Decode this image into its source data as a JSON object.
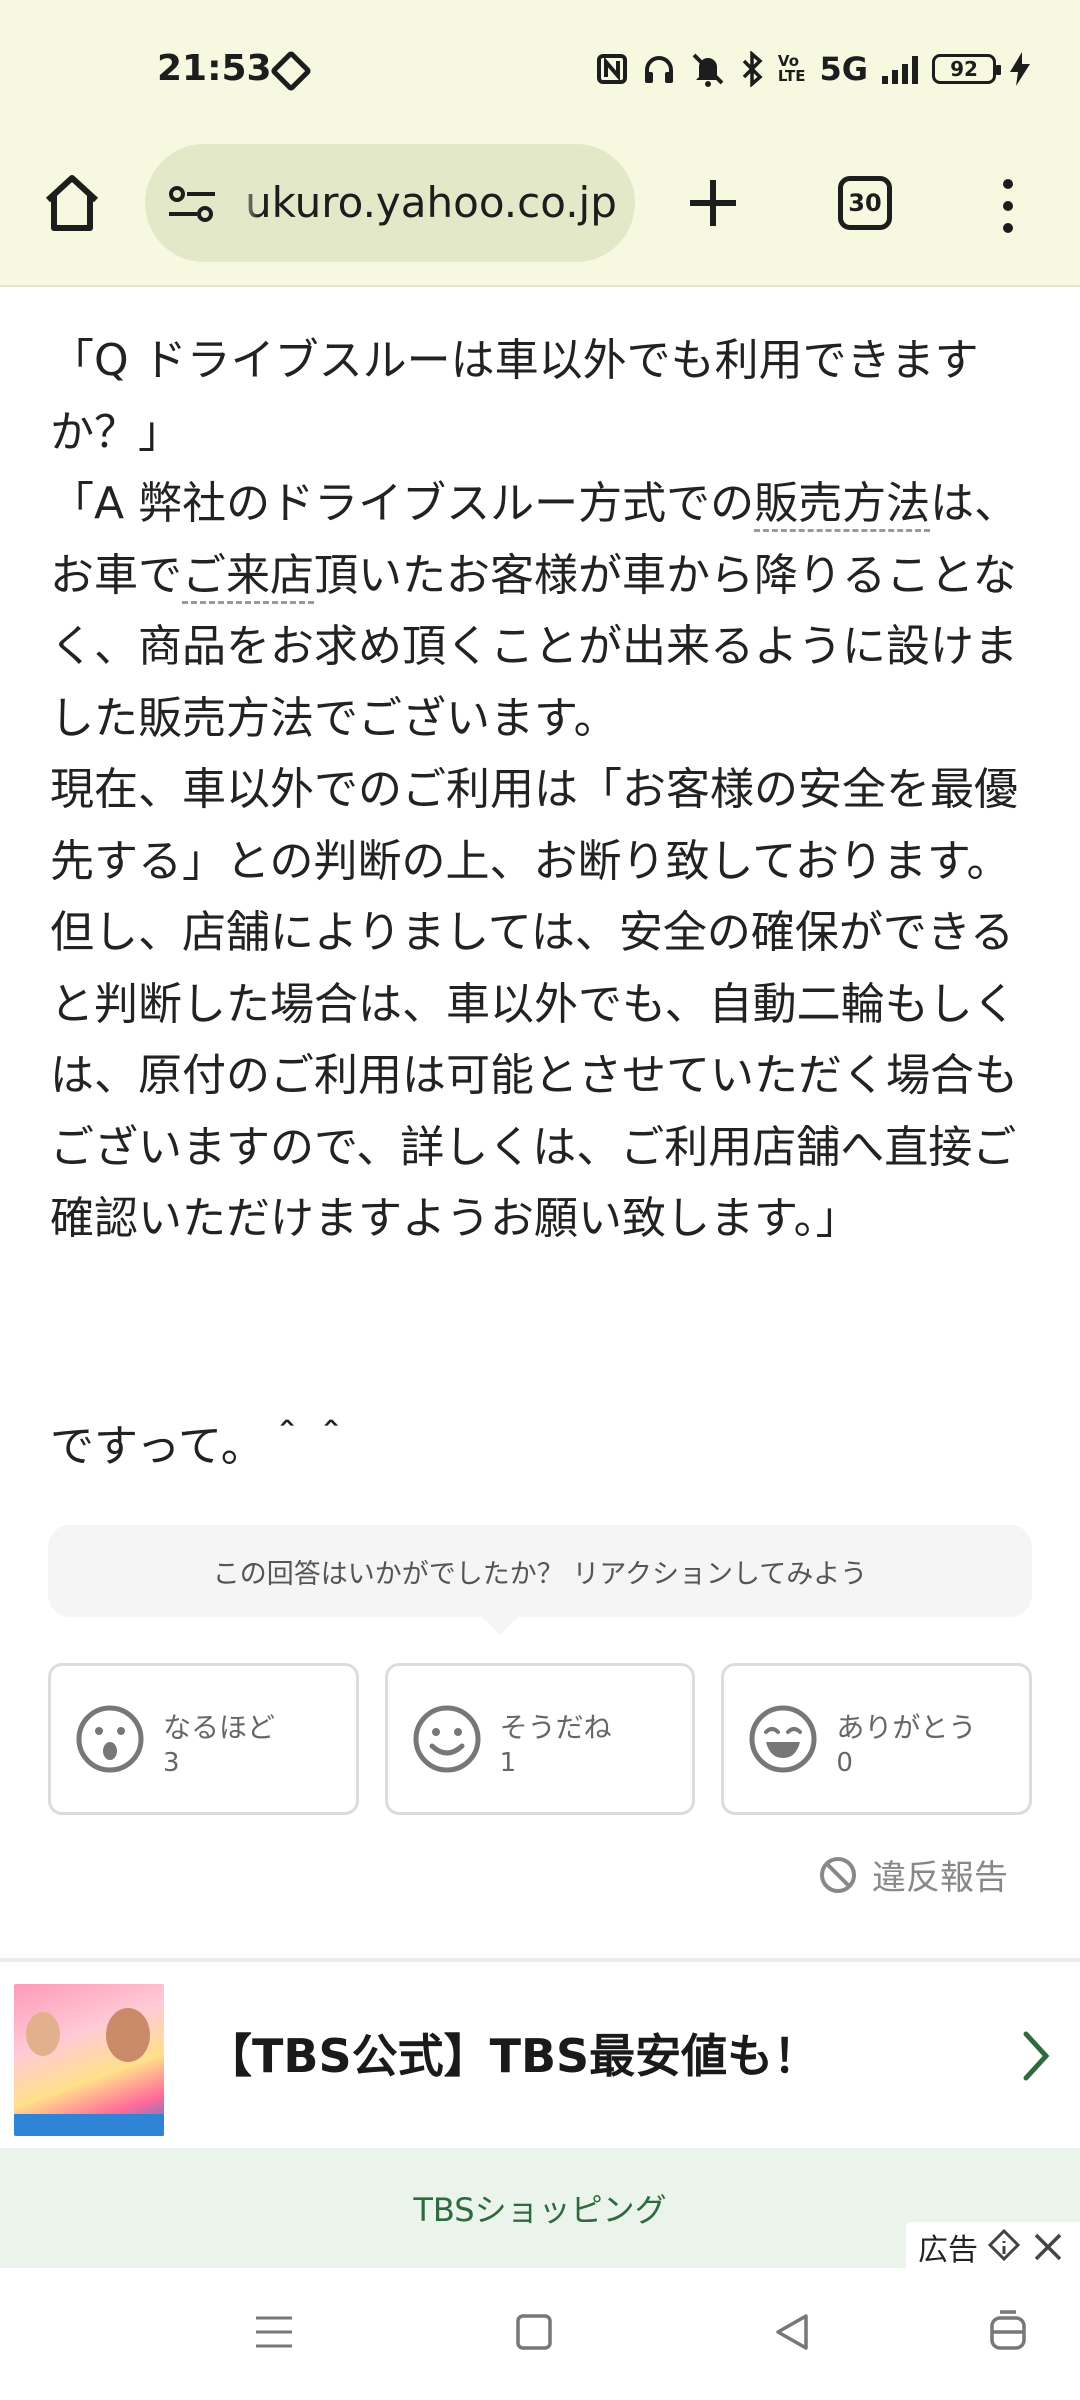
{
  "status_bar": {
    "time": "21:53",
    "network": "5G",
    "volte": "Vo\nLTE",
    "battery": "92"
  },
  "browser": {
    "url": "ukuro.yahoo.co.jp",
    "tab_count": "30"
  },
  "answer": {
    "lines": [
      "「Q ドライブスルーは車以外でも利用できますか？」",
      "「A 弊社のドライブスルー方式での",
      "販売方法",
      "は、お車で",
      "ご来店",
      "頂いたお客様が車から降りることなく、商品をお求め頂くことが出来るように設けました販売方法でございます。",
      "現在、車以外でのご利用は「お客様の安全を最優先する」との判断の上、お断り致しております。但し、店舗によりましては、安全の確保ができると判断した場合は、車以外でも、自動二輪もしくは、原付のご利用は可能とさせていただく場合もございますので、詳しくは、ご利用店舗へ直接ご確認いただけますようお願い致します。」"
    ],
    "after": "ですって。＾＾"
  },
  "reaction_prompt": "この回答はいかがでしたか？ リアクションしてみよう",
  "reactions": [
    {
      "label": "なるほど",
      "count": "3",
      "icon": "surprised-face-icon"
    },
    {
      "label": "そうだね",
      "count": "1",
      "icon": "smile-face-icon"
    },
    {
      "label": "ありがとう",
      "count": "0",
      "icon": "grin-face-icon"
    }
  ],
  "report_label": "違反報告",
  "ad": {
    "title": "【TBS公式】TBS最安値も！",
    "cta": "TBSショッピング",
    "badge": "広告"
  },
  "colors": {
    "chrome_bg": "#f6f9e0",
    "urlbar_bg": "#e3e8c8",
    "ad_cta_bg": "#eaf4ea",
    "ad_cta_text": "#2f6a3e"
  }
}
